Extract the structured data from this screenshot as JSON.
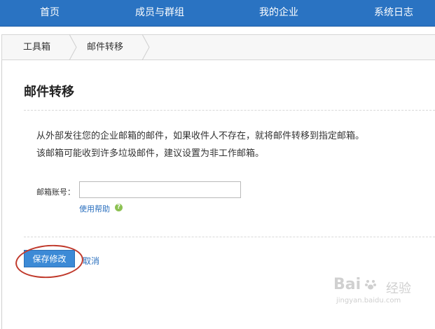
{
  "nav": {
    "items": [
      "首页",
      "成员与群组",
      "我的企业",
      "系统日志"
    ]
  },
  "breadcrumb": {
    "items": [
      "工具箱",
      "邮件转移"
    ]
  },
  "page": {
    "title": "邮件转移",
    "description_line1": "从外部发往您的企业邮箱的邮件，如果收件人不存在，就将邮件转移到指定邮箱。",
    "description_line2": "该邮箱可能收到许多垃圾邮件，建议设置为非工作邮箱。"
  },
  "form": {
    "email_label": "邮箱账号：",
    "email_value": "",
    "help_link": "使用帮助",
    "help_icon": "question-icon"
  },
  "actions": {
    "save_label": "保存修改",
    "cancel_label": "取消"
  },
  "watermark": {
    "brand": "Bai",
    "brand_suffix": "经验",
    "url": "jingyan.baidu.com"
  },
  "colors": {
    "nav_bg": "#2a73c2",
    "primary_button": "#3c8ad6",
    "link": "#2a6fbe",
    "highlight_ring": "#c0392b",
    "help_icon": "#8cc152"
  }
}
